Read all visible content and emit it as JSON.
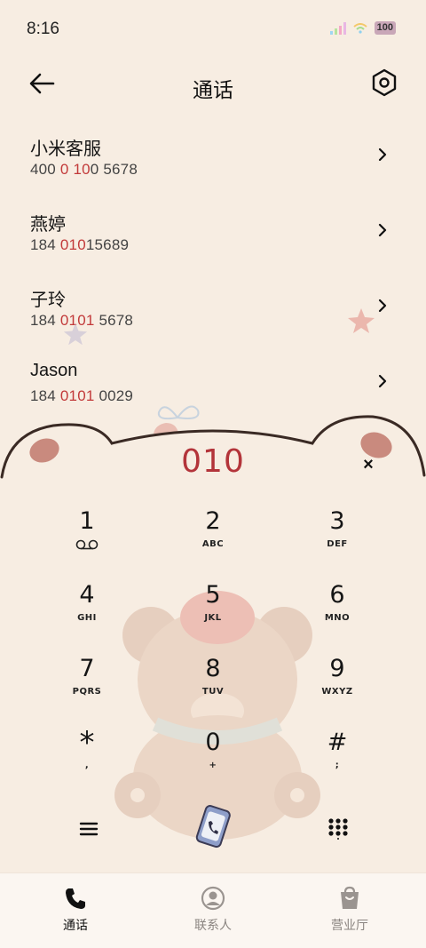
{
  "status_bar": {
    "time": "8:16",
    "battery": "100"
  },
  "header": {
    "title": "通话"
  },
  "contacts": [
    {
      "name": "小米客服",
      "number_pre": "400 ",
      "number_hl1": "0",
      "number_mid": " ",
      "number_hl2": "10",
      "number_post": "0 5678"
    },
    {
      "name": "燕婷",
      "number_pre": "184 ",
      "number_hl1": "010",
      "number_mid": "",
      "number_hl2": "",
      "number_post": "15689"
    },
    {
      "name": "子玲",
      "number_pre": "184 ",
      "number_hl1": "0101",
      "number_mid": "",
      "number_hl2": "",
      "number_post": " 5678"
    },
    {
      "name": "Jason",
      "number_pre": "184 ",
      "number_hl1": "0101",
      "number_mid": "",
      "number_hl2": "",
      "number_post": " 0029"
    }
  ],
  "dialer": {
    "display": "010",
    "clear_label": "×",
    "keys": [
      {
        "digit": "1",
        "letters": ""
      },
      {
        "digit": "2",
        "letters": "ABC"
      },
      {
        "digit": "3",
        "letters": "DEF"
      },
      {
        "digit": "4",
        "letters": "GHI"
      },
      {
        "digit": "5",
        "letters": "JKL"
      },
      {
        "digit": "6",
        "letters": "MNO"
      },
      {
        "digit": "7",
        "letters": "PQRS"
      },
      {
        "digit": "8",
        "letters": "TUV"
      },
      {
        "digit": "9",
        "letters": "WXYZ"
      },
      {
        "digit": "*",
        "letters": ","
      },
      {
        "digit": "0",
        "letters": "+"
      },
      {
        "digit": "#",
        "letters": ";"
      }
    ]
  },
  "bottom_nav": [
    {
      "label": "通话",
      "icon": "phone-icon",
      "active": true
    },
    {
      "label": "联系人",
      "icon": "person-icon",
      "active": false
    },
    {
      "label": "营业厅",
      "icon": "shop-bag-icon",
      "active": false
    }
  ],
  "colors": {
    "background": "#f7ede2",
    "highlight": "#c23a3a",
    "display_digits": "#b3343a"
  }
}
